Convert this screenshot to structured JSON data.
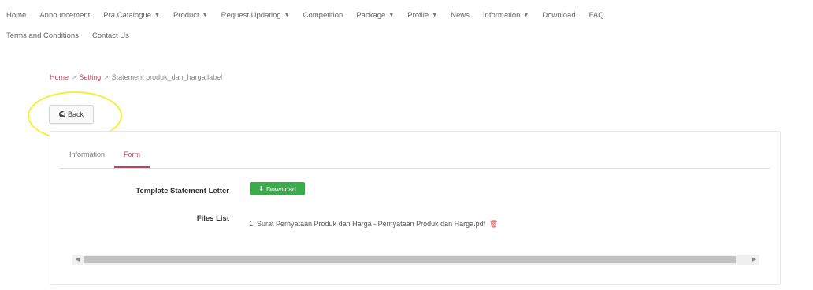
{
  "nav": {
    "row1": [
      {
        "label": "Home",
        "dropdown": false
      },
      {
        "label": "Announcement",
        "dropdown": false
      },
      {
        "label": "Pra Catalogue",
        "dropdown": true
      },
      {
        "label": "Product",
        "dropdown": true
      },
      {
        "label": "Request Updating",
        "dropdown": true
      },
      {
        "label": "Competition",
        "dropdown": false
      },
      {
        "label": "Package",
        "dropdown": true
      },
      {
        "label": "Profile",
        "dropdown": true
      },
      {
        "label": "News",
        "dropdown": false
      },
      {
        "label": "Information",
        "dropdown": true
      },
      {
        "label": "Download",
        "dropdown": false
      },
      {
        "label": "FAQ",
        "dropdown": false
      }
    ],
    "row2": [
      {
        "label": "Terms and Conditions",
        "dropdown": false
      },
      {
        "label": "Contact Us",
        "dropdown": false
      }
    ],
    "caret": "▼"
  },
  "breadcrumb": {
    "home": "Home",
    "setting": "Setting",
    "current": "Statement produk_dan_harga.label",
    "separator": ">"
  },
  "back_button": {
    "label": "Back",
    "icon": "arrow-left-circle-icon"
  },
  "tabs": [
    {
      "label": "Information",
      "active": false
    },
    {
      "label": "Form",
      "active": true
    }
  ],
  "form": {
    "template_label": "Template Statement Letter",
    "download_label": "Download",
    "files_label": "Files List",
    "files": [
      "1. Surat Pernyataan Produk dan Harga - Pernyataan Produk dan Harga.pdf"
    ]
  },
  "scrollbar": {
    "left_arrow": "◀",
    "right_arrow": "▶"
  },
  "colors": {
    "accent": "#b5485d",
    "download_green": "#3aaa4b",
    "highlight_yellow": "#f5ef3a",
    "delete_red": "#d9534f"
  }
}
